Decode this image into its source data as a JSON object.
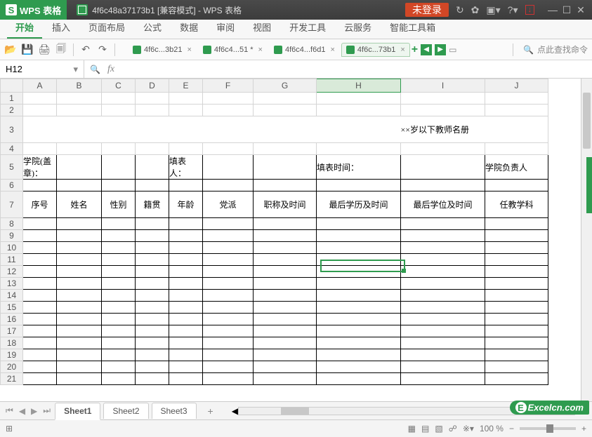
{
  "app": {
    "name": "WPS 表格",
    "doc_title": "4f6c48a37173b1 [兼容模式] - WPS 表格",
    "login": "未登录"
  },
  "ribbon": {
    "tabs": [
      "开始",
      "插入",
      "页面布局",
      "公式",
      "数据",
      "审阅",
      "视图",
      "开发工具",
      "云服务",
      "智能工具箱"
    ],
    "active": 0
  },
  "doctabs": {
    "items": [
      {
        "label": "4f6c...3b21"
      },
      {
        "label": "4f6c4...51 *"
      },
      {
        "label": "4f6c4...f6d1"
      },
      {
        "label": "4f6c...73b1"
      }
    ],
    "active": 3
  },
  "search_placeholder": "点此查找命令",
  "namebox": "H12",
  "columns": [
    "A",
    "B",
    "C",
    "D",
    "E",
    "F",
    "G",
    "H",
    "I",
    "J"
  ],
  "selected_col": "H",
  "rows_visible": 21,
  "content": {
    "title_row": 3,
    "title": "××岁以下教师名册",
    "row5": {
      "a": "学院(盖章)：",
      "e": "填表人：",
      "h": "填表时间：",
      "j": "学院负责人"
    },
    "header_row": 7,
    "headers": [
      "序号",
      "姓名",
      "性别",
      "籍贯",
      "年龄",
      "党派",
      "职称及时间",
      "最后学历及时间",
      "最后学位及时间",
      "任教学科"
    ]
  },
  "sheets": {
    "items": [
      "Sheet1",
      "Sheet2",
      "Sheet3"
    ],
    "active": 0
  },
  "status": {
    "zoom": "100 %"
  },
  "watermark": "Excelcn.com"
}
